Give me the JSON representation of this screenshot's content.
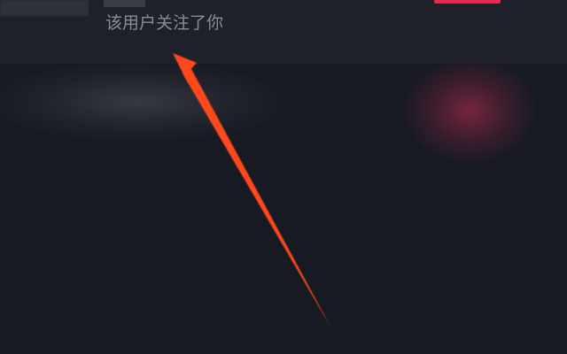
{
  "notification": {
    "text": "该用户关注了你"
  },
  "colors": {
    "background": "#181a23",
    "card": "#1e202a",
    "text_secondary": "#8a8c96",
    "accent": "#e8294e",
    "arrow": "#ff4a1c"
  },
  "annotation": {
    "icon": "arrow-icon"
  }
}
